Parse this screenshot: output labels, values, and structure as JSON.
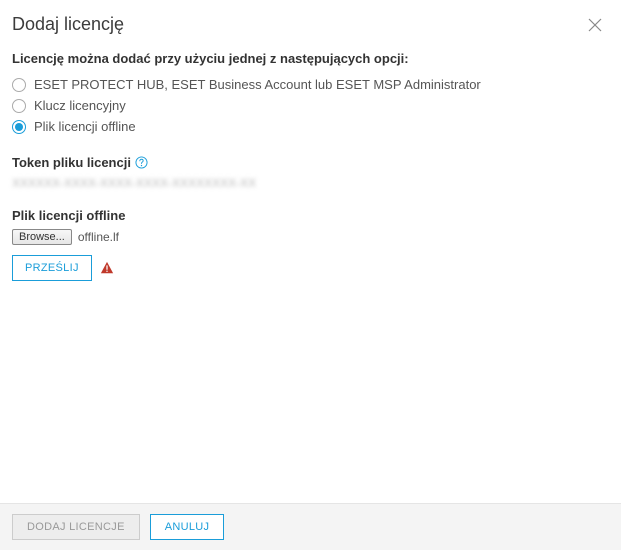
{
  "header": {
    "title": "Dodaj licencję"
  },
  "options": {
    "heading": "Licencję można dodać przy użyciu jednej z następujących opcji:",
    "items": [
      {
        "label": "ESET PROTECT HUB, ESET Business Account lub ESET MSP Administrator",
        "selected": false
      },
      {
        "label": "Klucz licencyjny",
        "selected": false
      },
      {
        "label": "Plik licencji offline",
        "selected": true
      }
    ]
  },
  "token": {
    "label": "Token pliku licencji",
    "value": "XXXXXX-XXXX-XXXX-XXXX-XXXXXXXX-XX"
  },
  "file": {
    "label": "Plik licencji offline",
    "browse": "Browse...",
    "filename": "offline.lf",
    "upload": "PRZEŚLIJ"
  },
  "footer": {
    "submit": "DODAJ LICENCJE",
    "cancel": "ANULUJ"
  }
}
